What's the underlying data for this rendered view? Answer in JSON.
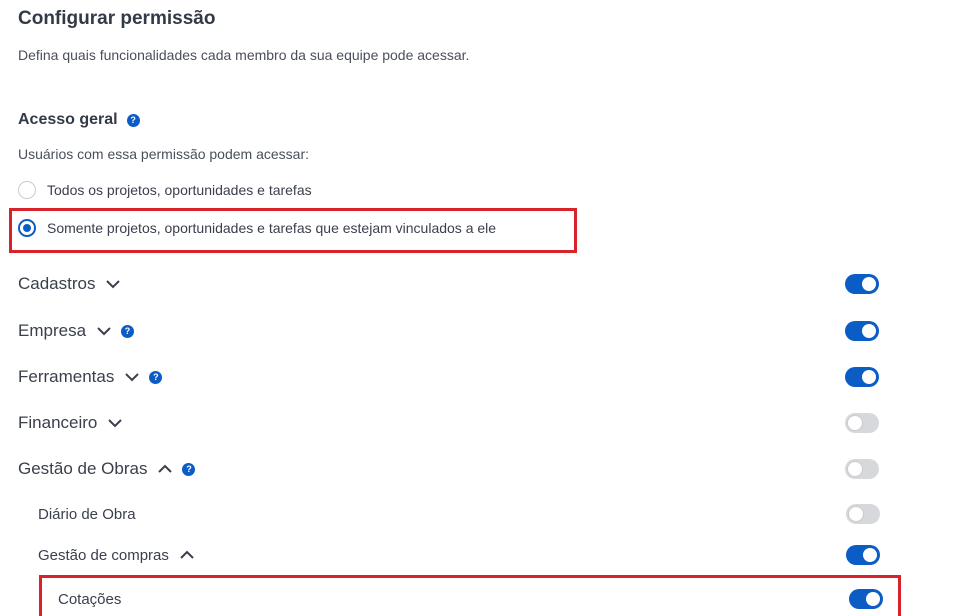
{
  "header": {
    "title": "Configurar permissão",
    "subtitle": "Defina quais funcionalidades cada membro da sua equipe pode acessar."
  },
  "general_access": {
    "title": "Acesso geral",
    "help_icon": "?",
    "description": "Usuários com essa permissão podem acessar:",
    "options": [
      {
        "label": "Todos os projetos, oportunidades e tarefas",
        "selected": false
      },
      {
        "label": "Somente projetos, oportunidades e tarefas que estejam vinculados a ele",
        "selected": true
      }
    ]
  },
  "permissions": [
    {
      "label": "Cadastros",
      "chevron": "down",
      "help": false,
      "enabled": true
    },
    {
      "label": "Empresa",
      "chevron": "down",
      "help": true,
      "enabled": true
    },
    {
      "label": "Ferramentas",
      "chevron": "down",
      "help": true,
      "enabled": true
    },
    {
      "label": "Financeiro",
      "chevron": "down",
      "help": false,
      "enabled": false
    },
    {
      "label": "Gestão de Obras",
      "chevron": "up",
      "help": true,
      "enabled": false,
      "children": [
        {
          "label": "Diário de Obra",
          "enabled": false
        },
        {
          "label": "Gestão de compras",
          "chevron": "up",
          "enabled": true,
          "children": [
            {
              "label": "Cotações",
              "enabled": true
            }
          ]
        }
      ]
    }
  ],
  "colors": {
    "accent": "#0b5cc5",
    "highlight": "#d8232a",
    "toggle_off": "#d7d8db"
  }
}
